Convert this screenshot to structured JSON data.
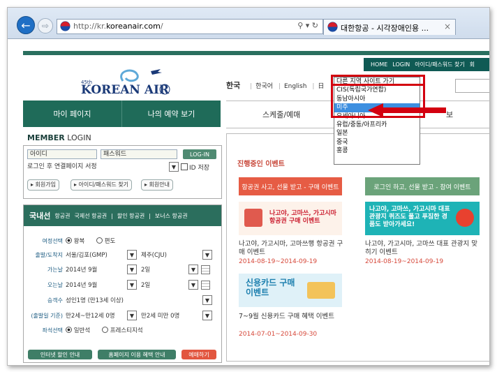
{
  "browser": {
    "url_prefix": "http://kr.",
    "url_domain": "koreanair.com",
    "url_suffix": "/",
    "addr_tools": "⚲ ▾ ↻",
    "tab_title": "대한항공 - 시각장애인용 ...",
    "tab_close": "×",
    "back_icon": "←",
    "forward_icon": "⇨"
  },
  "util": [
    "HOME",
    "LOGIN",
    "아이디/패스워드 찾기",
    "회"
  ],
  "logo": {
    "small": "45th",
    "text": "KOREAN AIR"
  },
  "lang": {
    "lead": "한국",
    "items": [
      "한국어",
      "English",
      "日"
    ]
  },
  "nav": {
    "left": [
      "마이 페이지",
      "나의 예약 보기"
    ],
    "menu1": "스케줄/예매",
    "menu2": "보"
  },
  "member": {
    "bold": "MEMBER",
    "rest": " LOGIN"
  },
  "login": {
    "id": "아이디",
    "pw": "패스워드",
    "btn": "LOG-IN",
    "saved_label": "로그인 후 연결페이지 서정",
    "id_save": "ID 저장",
    "links": [
      "▸ 회원가입",
      "▸ 아이디/패스워드 찾기",
      "▸ 회원안내"
    ]
  },
  "booking": {
    "tab_big": "국내선",
    "tabs": [
      "항공권",
      "국제선 항공권",
      "|",
      "할인 항공권",
      "|",
      "보너스 항공권"
    ],
    "trip_label": "여정선택",
    "roundtrip": "왕복",
    "oneway": "편도",
    "route_label": "출발/도착지",
    "from": "서울/김포(GMP)",
    "to": "제주(CJU)",
    "depart_label": "가는날",
    "depart_month": "2014년 9월",
    "depart_day": "2일",
    "return_label": "오는날",
    "return_month": "2014년 9월",
    "return_day": "2일",
    "pax_label": "승객수",
    "adult": "성인1명 (만13세 이상)",
    "age_label": "(출발일 기준)",
    "child": "만2세~만12세 0명",
    "infant": "만2세 미만 0명",
    "seat_label": "좌석선택",
    "economy": "일반석",
    "prestige": "프레스티지석",
    "btn1": "인터넷 할인 안내",
    "btn2": "홈페이지 이용 혜택 안내",
    "btn3": "예매하기"
  },
  "events": {
    "title": "진행중인 이벤트",
    "tab1": "항공권 사고, 선물 받고 - 구매 이벤트",
    "tab2": "로그인 하고, 선물 받고 - 참여 이벤트",
    "banner1": "나고야, 고마쓰, 가고시마 항공권 구매 이벤트",
    "banner2": "나고야, 고마쓰, 가고시마 대표 관광지 퀴즈도 풀고 푸짐한 경품도 받아가세요!",
    "ev1_text": "나고야, 가고시마, 고마쓰행 항공권 구매 이벤트",
    "ev1_date": "2014-08-19~2014-09-19",
    "ev2_text": "나고야, 가고시마, 고마쓰 대표 관광지 맞히기 이벤트",
    "ev2_date": "2014-08-19~2014-09-19",
    "banner3": "신용카드 구매 이벤트",
    "ev3_text": "7~9월 신용카드 구매 혜택 이벤트",
    "ev3_date": "2014-07-01~2014-09-30"
  },
  "dropdown": {
    "items": [
      "다른 지역 사이트 가기",
      "CIS(독립국가연합)",
      "동남아시아",
      "미주",
      "오세아니아",
      "유럽/중동/아프리카",
      "일본",
      "중국",
      "홍콩"
    ],
    "highlighted": "미주"
  },
  "colors": {
    "brand_green": "#1f6b59",
    "highlight_red": "#d3000f",
    "event_red": "#e65c44",
    "event_green": "#6ba37a"
  }
}
